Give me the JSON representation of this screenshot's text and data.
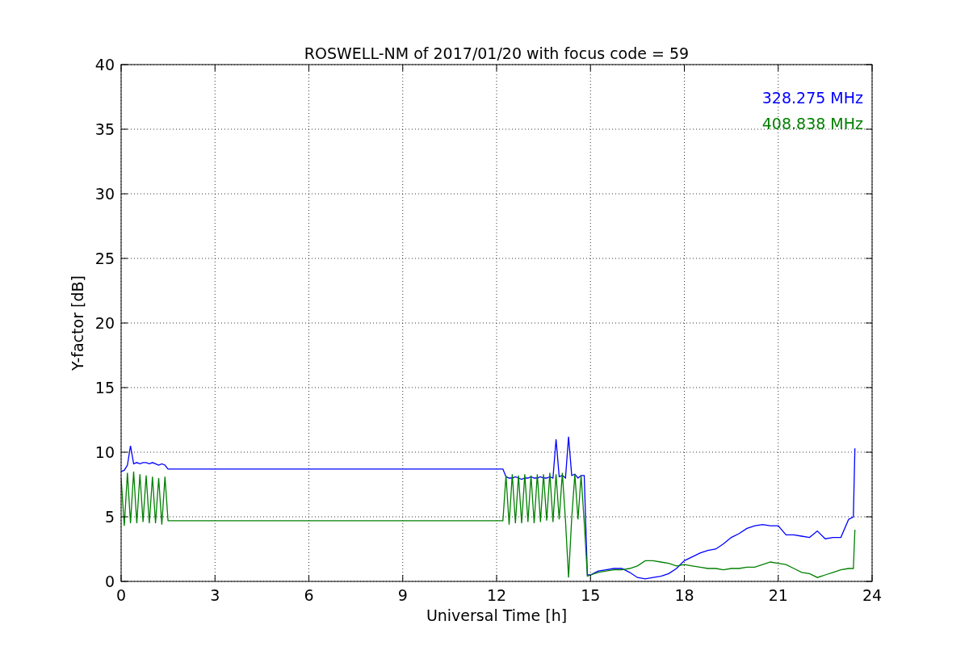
{
  "plot": {
    "chart_data": {
      "type": "line",
      "title": "ROSWELL-NM of 2017/01/20 with focus code = 59",
      "xlabel": "Universal Time [h]",
      "ylabel": "Y-factor [dB]",
      "x": [
        0,
        0.1,
        0.2,
        0.3,
        0.4,
        0.5,
        0.6,
        0.7,
        0.8,
        0.9,
        1.0,
        1.1,
        1.2,
        1.3,
        1.4,
        1.5,
        12.2,
        12.3,
        12.4,
        12.5,
        12.6,
        12.7,
        12.8,
        12.9,
        13.0,
        13.1,
        13.2,
        13.3,
        13.4,
        13.5,
        13.6,
        13.7,
        13.8,
        13.9,
        14.0,
        14.1,
        14.2,
        14.3,
        14.4,
        14.5,
        14.6,
        14.7,
        14.8,
        14.9,
        15,
        15.25,
        15.5,
        15.75,
        16,
        16.25,
        16.5,
        16.75,
        17,
        17.25,
        17.5,
        17.75,
        18,
        18.25,
        18.5,
        18.75,
        19,
        19.25,
        19.5,
        19.75,
        20,
        20.25,
        20.5,
        20.75,
        21,
        21.25,
        21.5,
        21.75,
        22,
        22.25,
        22.5,
        22.75,
        23,
        23.25,
        23.4,
        23.45
      ],
      "series": [
        {
          "name": "328.275 MHz",
          "color": "#0000ff",
          "values": [
            8.5,
            8.6,
            9.0,
            10.5,
            9.1,
            9.2,
            9.1,
            9.2,
            9.2,
            9.1,
            9.2,
            9.1,
            9.0,
            9.1,
            9.0,
            8.7,
            8.7,
            8.1,
            8.0,
            8.0,
            8.1,
            8.0,
            7.9,
            8.0,
            8.0,
            8.1,
            8.0,
            8.0,
            8.1,
            8.0,
            8.0,
            8.1,
            8.0,
            11.0,
            8.1,
            8.2,
            8.0,
            11.2,
            8.2,
            8.3,
            8.0,
            8.2,
            8.2,
            0.5,
            0.5,
            0.8,
            0.9,
            1.0,
            1.0,
            0.7,
            0.3,
            0.2,
            0.3,
            0.4,
            0.6,
            1.0,
            1.6,
            1.9,
            2.2,
            2.4,
            2.5,
            2.9,
            3.4,
            3.7,
            4.1,
            4.3,
            4.4,
            4.3,
            4.3,
            3.6,
            3.6,
            3.5,
            3.4,
            3.9,
            3.3,
            3.4,
            3.4,
            4.8,
            5.0,
            10.3
          ]
        },
        {
          "name": "408.838 MHz",
          "color": "#008000",
          "values": [
            8.0,
            4.3,
            8.4,
            4.5,
            8.5,
            4.5,
            8.3,
            4.6,
            8.2,
            4.5,
            8.1,
            4.5,
            8.0,
            4.4,
            8.1,
            4.7,
            4.7,
            8.2,
            4.4,
            8.3,
            4.5,
            8.2,
            4.5,
            8.3,
            4.6,
            8.2,
            4.5,
            8.3,
            4.6,
            8.3,
            4.7,
            8.4,
            4.6,
            8.3,
            4.8,
            8.4,
            4.7,
            0.3,
            4.9,
            8.3,
            4.8,
            8.2,
            4.6,
            0.4,
            0.5,
            0.7,
            0.8,
            0.9,
            0.9,
            1.0,
            1.2,
            1.6,
            1.6,
            1.5,
            1.4,
            1.2,
            1.3,
            1.2,
            1.1,
            1.0,
            1.0,
            0.9,
            1.0,
            1.0,
            1.1,
            1.1,
            1.3,
            1.5,
            1.4,
            1.3,
            1.0,
            0.7,
            0.6,
            0.3,
            0.5,
            0.7,
            0.9,
            1.0,
            1.0,
            4.0
          ]
        }
      ],
      "xlim": [
        0,
        24
      ],
      "ylim": [
        0,
        40
      ],
      "xticks": [
        0,
        3,
        6,
        9,
        12,
        15,
        18,
        21,
        24
      ],
      "yticks": [
        0,
        5,
        10,
        15,
        20,
        25,
        30,
        35,
        40
      ],
      "grid": true
    }
  }
}
